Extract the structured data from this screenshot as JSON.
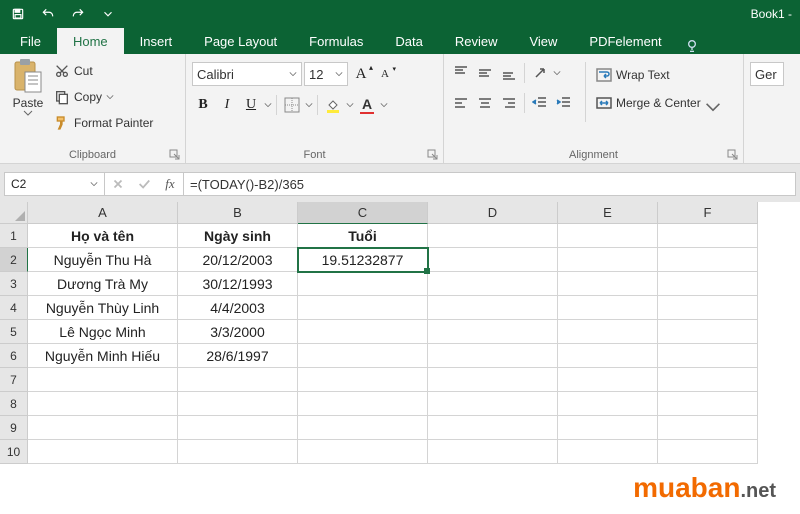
{
  "titlebar": {
    "title": "Book1 -"
  },
  "tabs": {
    "file": "File",
    "home": "Home",
    "insert": "Insert",
    "page_layout": "Page Layout",
    "formulas": "Formulas",
    "data": "Data",
    "review": "Review",
    "view": "View",
    "pdfelement": "PDFelement"
  },
  "ribbon": {
    "clipboard": {
      "label": "Clipboard",
      "paste": "Paste",
      "cut": "Cut",
      "copy": "Copy",
      "format_painter": "Format Painter"
    },
    "font": {
      "label": "Font",
      "font_name": "Calibri",
      "font_size": "12",
      "grow": "A",
      "shrink": "A",
      "bold": "B",
      "italic": "I",
      "underline": "U"
    },
    "alignment": {
      "label": "Alignment",
      "wrap_text": "Wrap Text",
      "merge_center": "Merge & Center"
    },
    "number": {
      "general": "Ger"
    }
  },
  "formula_bar": {
    "cell_ref": "C2",
    "fx": "fx",
    "formula": "=(TODAY()-B2)/365"
  },
  "columns": [
    "A",
    "B",
    "C",
    "D",
    "E",
    "F"
  ],
  "row_numbers": [
    "1",
    "2",
    "3",
    "4",
    "5",
    "6",
    "7",
    "8",
    "9",
    "10"
  ],
  "sheet": {
    "headers": {
      "A": "Họ và tên",
      "B": "Ngày sinh",
      "C": "Tuổi"
    },
    "rows": [
      {
        "A": "Nguyễn Thu Hà",
        "B": "20/12/2003",
        "C": "19.51232877"
      },
      {
        "A": "Dương Trà My",
        "B": "30/12/1993",
        "C": ""
      },
      {
        "A": "Nguyễn Thùy Linh",
        "B": "4/4/2003",
        "C": ""
      },
      {
        "A": "Lê Ngọc Minh",
        "B": "3/3/2000",
        "C": ""
      },
      {
        "A": "Nguyễn Minh Hiếu",
        "B": "28/6/1997",
        "C": ""
      }
    ]
  },
  "selection": {
    "active_cell": "C2"
  },
  "watermark": {
    "brand": "muaban",
    "tld": ".net"
  }
}
